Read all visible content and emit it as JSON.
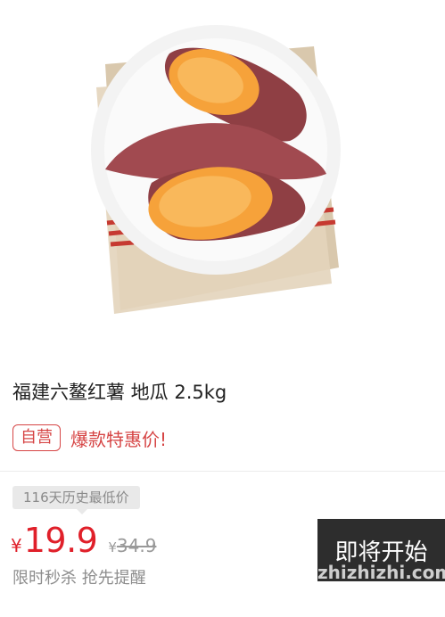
{
  "product": {
    "title": "福建六鳌红薯 地瓜 2.5kg",
    "badge": "自营",
    "promo_text": "爆款特惠价!",
    "history_tag": "116天历史最低价",
    "currency": "¥",
    "price": "19.9",
    "original_currency": "¥",
    "original_price": "34.9",
    "flash_label": "限时秒杀 抢先提醒",
    "cta_label": "即将开始"
  },
  "watermark": "zhizhizhi.com",
  "colors": {
    "accent": "#e0202a",
    "badge": "#d64545",
    "cta_bg": "#2d2d2d"
  }
}
